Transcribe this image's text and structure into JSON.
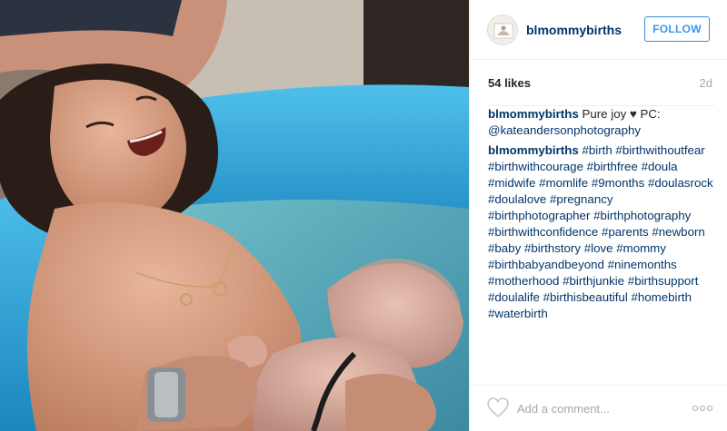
{
  "post": {
    "username": "blmommybirths",
    "follow_label": "FOLLOW",
    "likes": "54 likes",
    "age": "2d",
    "caption": {
      "author": "blmommybirths",
      "text": "Pure joy",
      "heart": "♥",
      "credit_prefix": "PC:",
      "credit_handle": "@kateandersonphotography"
    },
    "hashtag_comment": {
      "author": "blmommybirths",
      "tags": [
        "#birth",
        "#birthwithoutfear",
        "#birthwithcourage",
        "#birthfree",
        "#doula",
        "#midwife",
        "#momlife",
        "#9months",
        "#doulasrock",
        "#doulalove",
        "#pregnancy",
        "#birthphotographer",
        "#birthphotography",
        "#birthwithconfidence",
        "#parents",
        "#newborn",
        "#baby",
        "#birthstory",
        "#love",
        "#mommy",
        "#birthbabyandbeyond",
        "#ninemonths",
        "#motherhood",
        "#birthjunkie",
        "#birthsupport",
        "#doulalife",
        "#birthisbeautiful",
        "#homebirth",
        "#waterbirth"
      ]
    },
    "comment_placeholder": "Add a comment...",
    "icons": {
      "like": "heart-outline-icon",
      "more": "more-options-icon",
      "avatar": "profile-avatar"
    },
    "colors": {
      "username": "#003569",
      "follow": "#3897f0",
      "meta": "#a5a7aa",
      "pool": "#2aa3d6"
    }
  }
}
